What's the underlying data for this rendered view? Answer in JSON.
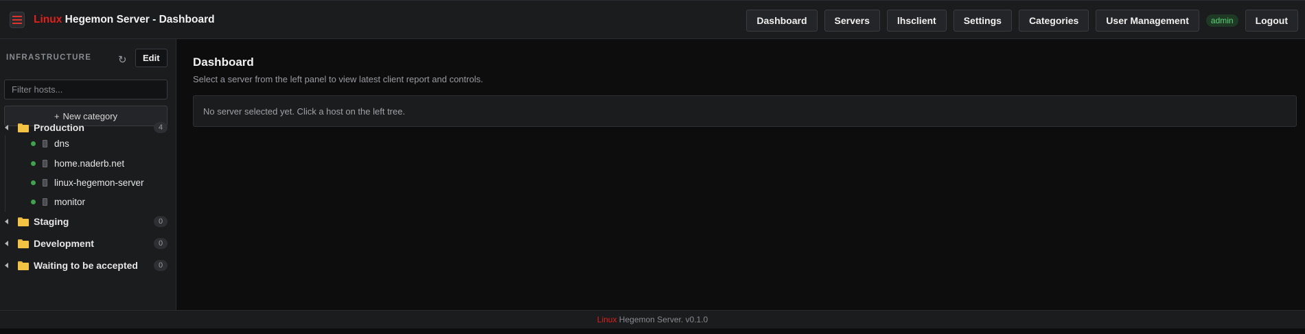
{
  "header": {
    "brand_red": "Linux",
    "title_rest": " Hegemon Server - Dashboard",
    "nav": [
      {
        "id": "dashboard",
        "label": "Dashboard"
      },
      {
        "id": "servers",
        "label": "Servers"
      },
      {
        "id": "lhsclient",
        "label": "lhsclient"
      },
      {
        "id": "settings",
        "label": "Settings"
      },
      {
        "id": "categories",
        "label": "Categories"
      },
      {
        "id": "user-management",
        "label": "User Management"
      }
    ],
    "user": "admin",
    "logout_label": "Logout"
  },
  "sidebar": {
    "heading": "INFRASTRUCTURE",
    "refresh_icon": "↻",
    "edit_label": "Edit",
    "filter_placeholder": "Filter hosts...",
    "new_category_label": "New category",
    "categories": [
      {
        "name": "Production",
        "count": "4",
        "hosts": [
          "dns",
          "home.naderb.net",
          "linux-hegemon-server",
          "monitor"
        ]
      },
      {
        "name": "Staging",
        "count": "0",
        "hosts": []
      },
      {
        "name": "Development",
        "count": "0",
        "hosts": []
      },
      {
        "name": "Waiting to be accepted",
        "count": "0",
        "hosts": []
      }
    ]
  },
  "main": {
    "title": "Dashboard",
    "subtitle": "Select a server from the left panel to view latest client report and controls.",
    "empty_message": "No server selected yet. Click a host on the left tree."
  },
  "footer": {
    "brand_red": "Linux",
    "text_rest": " Hegemon Server. v0.1.0"
  },
  "colors": {
    "accent_red": "#e0201b",
    "online_green": "#3fa34d",
    "folder_yellow": "#f5c343"
  }
}
